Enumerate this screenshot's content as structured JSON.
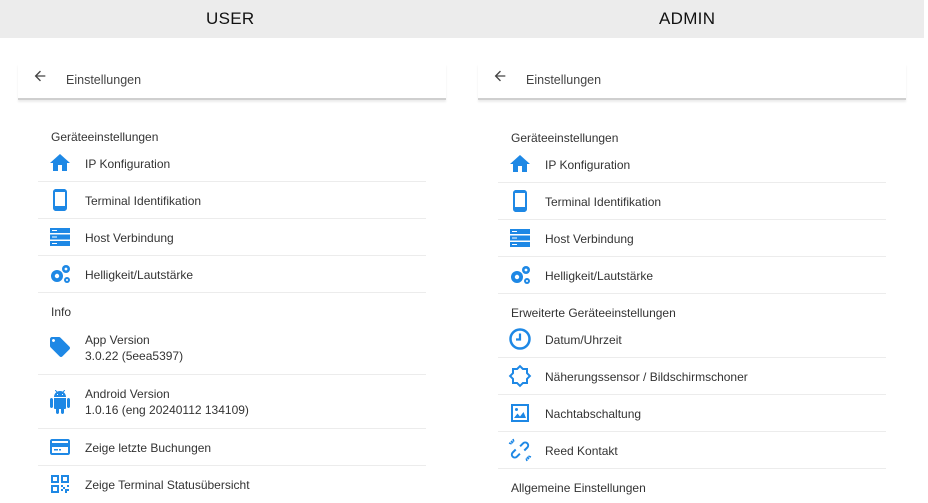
{
  "header": {
    "user_label": "USER",
    "admin_label": "ADMIN"
  },
  "user": {
    "appbar_title": "Einstellungen",
    "section_device": "Geräteeinstellungen",
    "section_info": "Info",
    "items": [
      {
        "label": "IP Konfiguration",
        "icon": "home-icon"
      },
      {
        "label": "Terminal Identifikation",
        "icon": "smartphone-icon"
      },
      {
        "label": "Host Verbindung",
        "icon": "server-icon"
      },
      {
        "label": "Helligkeit/Lautstärke",
        "icon": "gears-icon"
      },
      {
        "label": "App Version",
        "value": "3.0.22 (5eea5397)",
        "icon": "tag-icon"
      },
      {
        "label": "Android Version",
        "value": "1.0.16 (eng 20240112 134109)",
        "icon": "android-icon"
      },
      {
        "label": "Zeige letzte Buchungen",
        "icon": "credit-card-icon"
      },
      {
        "label": "Zeige Terminal Statusübersicht",
        "icon": "qr-code-icon"
      }
    ]
  },
  "admin": {
    "appbar_title": "Einstellungen",
    "section_device": "Geräteeinstellungen",
    "section_advanced": "Erweiterte Geräteeinstellungen",
    "section_general": "Allgemeine Einstellungen",
    "items": [
      {
        "label": "IP Konfiguration",
        "icon": "home-icon"
      },
      {
        "label": "Terminal Identifikation",
        "icon": "smartphone-icon"
      },
      {
        "label": "Host Verbindung",
        "icon": "server-icon"
      },
      {
        "label": "Helligkeit/Lautstärke",
        "icon": "gears-icon"
      },
      {
        "label": "Datum/Uhrzeit",
        "icon": "clock-icon"
      },
      {
        "label": "Näherungssensor / Bildschirmschoner",
        "icon": "sun-icon"
      },
      {
        "label": "Nachtabschaltung",
        "icon": "image-icon"
      },
      {
        "label": "Reed Kontakt",
        "icon": "link-off-icon"
      }
    ]
  },
  "colors": {
    "icon_blue": "#1e88e5",
    "divider": "#ececec",
    "band": "#ececec"
  }
}
